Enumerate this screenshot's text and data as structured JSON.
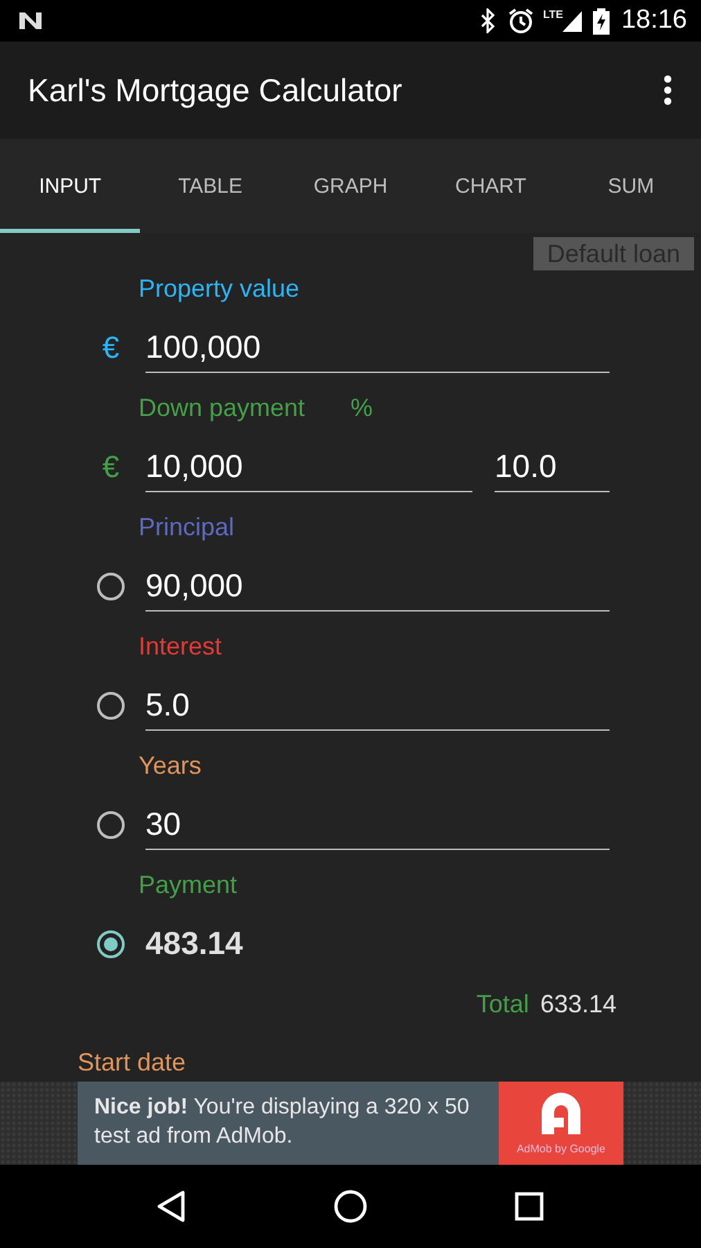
{
  "status_bar": {
    "network": "LTE",
    "time": "18:16"
  },
  "app_bar": {
    "title": "Karl's Mortgage Calculator"
  },
  "tabs": [
    {
      "label": "INPUT",
      "selected": true
    },
    {
      "label": "TABLE",
      "selected": false
    },
    {
      "label": "GRAPH",
      "selected": false
    },
    {
      "label": "CHART",
      "selected": false
    },
    {
      "label": "SUM",
      "selected": false
    }
  ],
  "default_button": "Default loan",
  "fields": [
    {
      "kind": "currency",
      "label": "Property value",
      "color": "#29b6f6",
      "prefix": "€",
      "value": "100,000"
    },
    {
      "kind": "currency",
      "label": "Down payment",
      "color": "#43a047",
      "prefix": "€",
      "value": "10,000",
      "percent": {
        "label": "%",
        "value": "10.0"
      }
    },
    {
      "kind": "radio",
      "label": "Principal",
      "color": "#5c6bc0",
      "value": "90,000",
      "selected": false
    },
    {
      "kind": "radio",
      "label": "Interest",
      "color": "#e53935",
      "value": "5.0",
      "selected": false
    },
    {
      "kind": "radio",
      "label": "Years",
      "color": "#e0955a",
      "value": "30",
      "selected": false
    },
    {
      "kind": "radio",
      "label": "Payment",
      "color": "#43a047",
      "value": "483.14",
      "selected": true
    }
  ],
  "total": {
    "label": "Total",
    "value": "633.14"
  },
  "start_date": {
    "label": "Start date"
  },
  "ad": {
    "text": "**Nice job!** You're displaying a 320 x 50 test ad from AdMob.",
    "logo_caption": "AdMob by Google"
  }
}
